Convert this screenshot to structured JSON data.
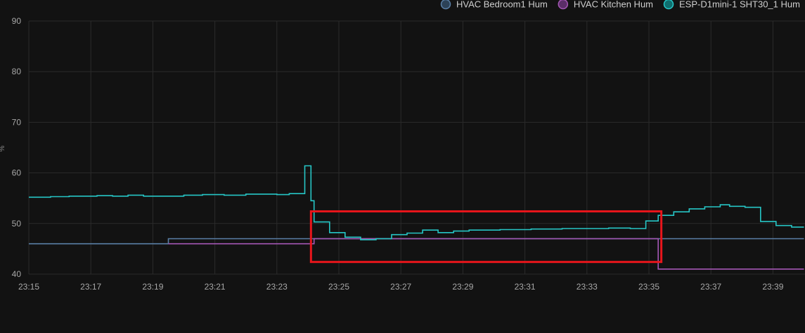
{
  "chart_data": {
    "type": "line",
    "step": true,
    "xlabel": "",
    "ylabel": "%",
    "ylim": [
      40,
      90
    ],
    "yticks": [
      "40",
      "50",
      "60",
      "70",
      "80",
      "90"
    ],
    "xlim": [
      "23:15",
      "23:40"
    ],
    "xticks": [
      "23:15",
      "23:17",
      "23:19",
      "23:21",
      "23:23",
      "23:25",
      "23:27",
      "23:29",
      "23:31",
      "23:33",
      "23:35",
      "23:37",
      "23:39"
    ],
    "grid": true,
    "legend_position": "top-right",
    "series": [
      {
        "name": "HVAC Bedroom1 Hum",
        "color": "#5a7fa6",
        "marker_fill": "#2c4258",
        "x": [
          "23:15",
          "23:19.5",
          "23:40"
        ],
        "y": [
          46.0,
          47.0,
          47.0
        ]
      },
      {
        "name": "HVAC Kitchen Hum",
        "color": "#a557b5",
        "marker_fill": "#5b2e68",
        "x": [
          "23:19.5",
          "23:24.2",
          "23:35.3",
          "23:40"
        ],
        "y": [
          46.0,
          47.0,
          41.0,
          41.0
        ]
      },
      {
        "name": "ESP-D1mini-1 SHT30_1 Hum",
        "color": "#26c6c6",
        "marker_fill": "#0f6e6e",
        "x": [
          "23:15",
          "23:15.7",
          "23:16.3",
          "23:17.2",
          "23:17.7",
          "23:18.2",
          "23:18.7",
          "23:20",
          "23:20.6",
          "23:21.3",
          "23:22",
          "23:22.5",
          "23:23",
          "23:23.4",
          "23:23.9",
          "23:24.1",
          "23:24.2",
          "23:24.7",
          "23:25.2",
          "23:25.7",
          "23:26.2",
          "23:26.7",
          "23:27.2",
          "23:27.7",
          "23:28.2",
          "23:28.7",
          "23:29.2",
          "23:30.2",
          "23:31.2",
          "23:32.2",
          "23:33.2",
          "23:33.7",
          "23:34.4",
          "23:34.9",
          "23:35.3",
          "23:35.8",
          "23:36.3",
          "23:36.8",
          "23:37.3",
          "23:37.6",
          "23:38.1",
          "23:38.6",
          "23:39.1",
          "23:39.6",
          "23:40"
        ],
        "y": [
          55.2,
          55.3,
          55.4,
          55.5,
          55.4,
          55.6,
          55.4,
          55.6,
          55.7,
          55.6,
          55.8,
          55.8,
          55.7,
          55.9,
          61.4,
          54.5,
          50.3,
          48.2,
          47.3,
          46.8,
          47.0,
          47.8,
          48.1,
          48.7,
          48.2,
          48.5,
          48.7,
          48.8,
          48.9,
          49.0,
          49.0,
          49.1,
          49.0,
          50.5,
          51.6,
          52.3,
          52.9,
          53.3,
          53.7,
          53.4,
          53.2,
          50.4,
          49.6,
          49.3,
          49.3
        ]
      }
    ],
    "annotations": [
      {
        "type": "highlight-box",
        "color": "#e8151b",
        "x_range": [
          "23:24.1",
          "23:35.4"
        ],
        "y_range": [
          42.4,
          52.4
        ]
      }
    ]
  }
}
